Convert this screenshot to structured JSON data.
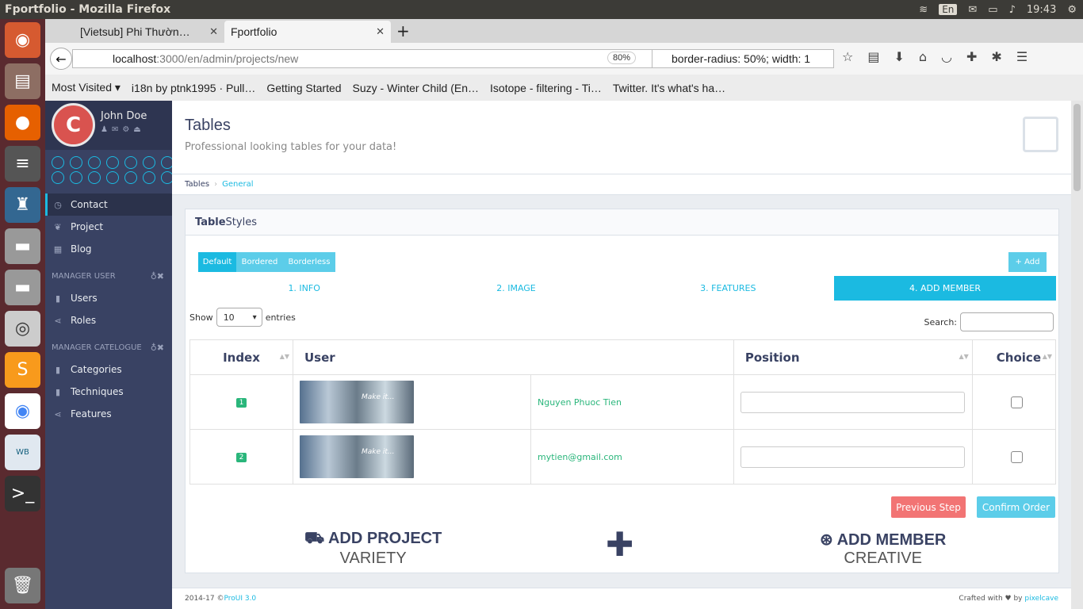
{
  "window": {
    "title": "Fportfolio - Mozilla Firefox",
    "lang": "En",
    "time": "19:43"
  },
  "tabs": [
    {
      "label": "[Vietsub] Phi Thườn…"
    },
    {
      "label": "Fportfolio"
    }
  ],
  "url": {
    "host": "localhost",
    "path": ":3000/en/admin/projects/new",
    "zoom": "80%"
  },
  "search": {
    "value": "border-radius: 50%; width: 1"
  },
  "bookmarks": [
    "Most Visited ▾",
    "i18n by ptnk1995 · Pull…",
    "Getting Started",
    "Suzy - Winter Child (En…",
    "Isotope - filtering - Ti…",
    "Twitter. It's what's ha…"
  ],
  "sidebar": {
    "user": "John Doe",
    "items": [
      {
        "label": "Contact"
      },
      {
        "label": "Project"
      },
      {
        "label": "Blog"
      }
    ],
    "h1": "MANAGER USER",
    "items2": [
      {
        "label": "Users"
      },
      {
        "label": "Roles"
      }
    ],
    "h2": "MANAGER CATELOGUE",
    "items3": [
      {
        "label": "Categories"
      },
      {
        "label": "Techniques"
      },
      {
        "label": "Features"
      }
    ]
  },
  "page": {
    "title": "Tables",
    "subtitle": "Professional looking tables for your data!",
    "crumb1": "Tables",
    "crumb2": "General",
    "block_title_b": "Table",
    "block_title": " Styles",
    "btn_default": "Default",
    "btn_bordered": "Bordered",
    "btn_borderless": "Borderless",
    "add": "+ Add",
    "steps": [
      "1. INFO",
      "2. IMAGE",
      "3. FEATURES",
      "4. ADD MEMBER"
    ],
    "show": "Show",
    "entries": "entries",
    "entries_val": "10",
    "search_label": "Search:",
    "cols": [
      "Index",
      "User",
      "Position",
      "Choice"
    ],
    "rows": [
      {
        "index": "1",
        "name": "Nguyen Phuoc Tien"
      },
      {
        "index": "2",
        "name": "mytien@gmail.com"
      }
    ],
    "prev": "Previous Step",
    "confirm": "Confirm Order",
    "f1a": "ADD PROJECT",
    "f1b": "VARIETY",
    "f2a": "ADD MEMBER",
    "f2b": "CREATIVE"
  },
  "footer": {
    "left": "2014-17 © ",
    "leftlink": "ProUI 3.0",
    "right": "Crafted with ♥ by ",
    "rightlink": "pixelcave"
  }
}
